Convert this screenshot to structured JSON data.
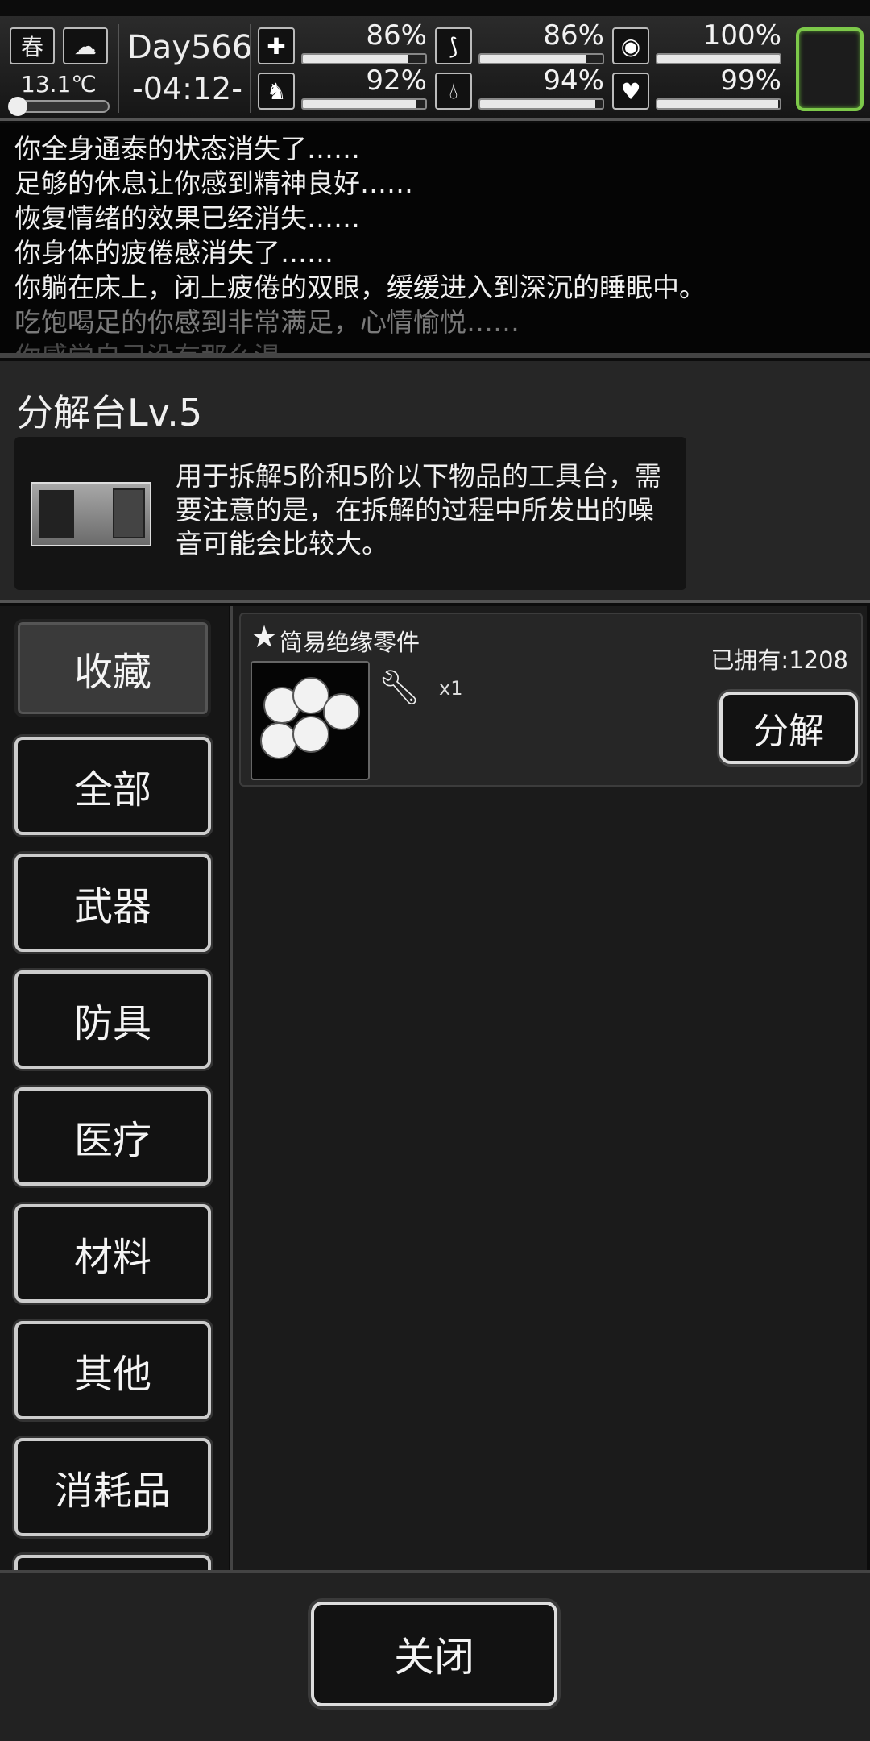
{
  "status": {
    "season": "春",
    "temperature": "13.1℃",
    "temperature_level": 0.05,
    "day": "Day566",
    "time": "-04:12-",
    "stats": [
      {
        "icon": "medkit-icon",
        "value_text": "86%",
        "value": 86
      },
      {
        "icon": "stomach-icon",
        "value_text": "86%",
        "value": 86
      },
      {
        "icon": "pill-icon",
        "value_text": "100%",
        "value": 100
      },
      {
        "icon": "foot-icon",
        "value_text": "92%",
        "value": 92
      },
      {
        "icon": "water-drop-icon",
        "value_text": "94%",
        "value": 94
      },
      {
        "icon": "heart-icon",
        "value_text": "99%",
        "value": 99
      }
    ],
    "highlight_color": "#7dc94a"
  },
  "log": [
    "你全身通泰的状态消失了……",
    "足够的休息让你感到精神良好……",
    "恢复情绪的效果已经消失……",
    "你身体的疲倦感消失了……",
    "你躺在床上，闭上疲倦的双眼，缓缓进入到深沉的睡眠中。",
    "吃饱喝足的你感到非常满足，心情愉悦……",
    "你感觉自己没有那么渴……"
  ],
  "bench": {
    "title": "分解台Lv.5",
    "description": "用于拆解5阶和5阶以下物品的工具台，需要注意的是，在拆解的过程中所发出的噪音可能会比较大。"
  },
  "categories": [
    "收藏",
    "全部",
    "武器",
    "防具",
    "医疗",
    "材料",
    "其他",
    "消耗品"
  ],
  "active_category": "收藏",
  "items": [
    {
      "name": "简易绝缘零件",
      "owned": "已拥有:1208",
      "yield_qty": "x1",
      "action": "分解",
      "favorited": true
    }
  ],
  "footer": {
    "close_label": "关闭"
  }
}
